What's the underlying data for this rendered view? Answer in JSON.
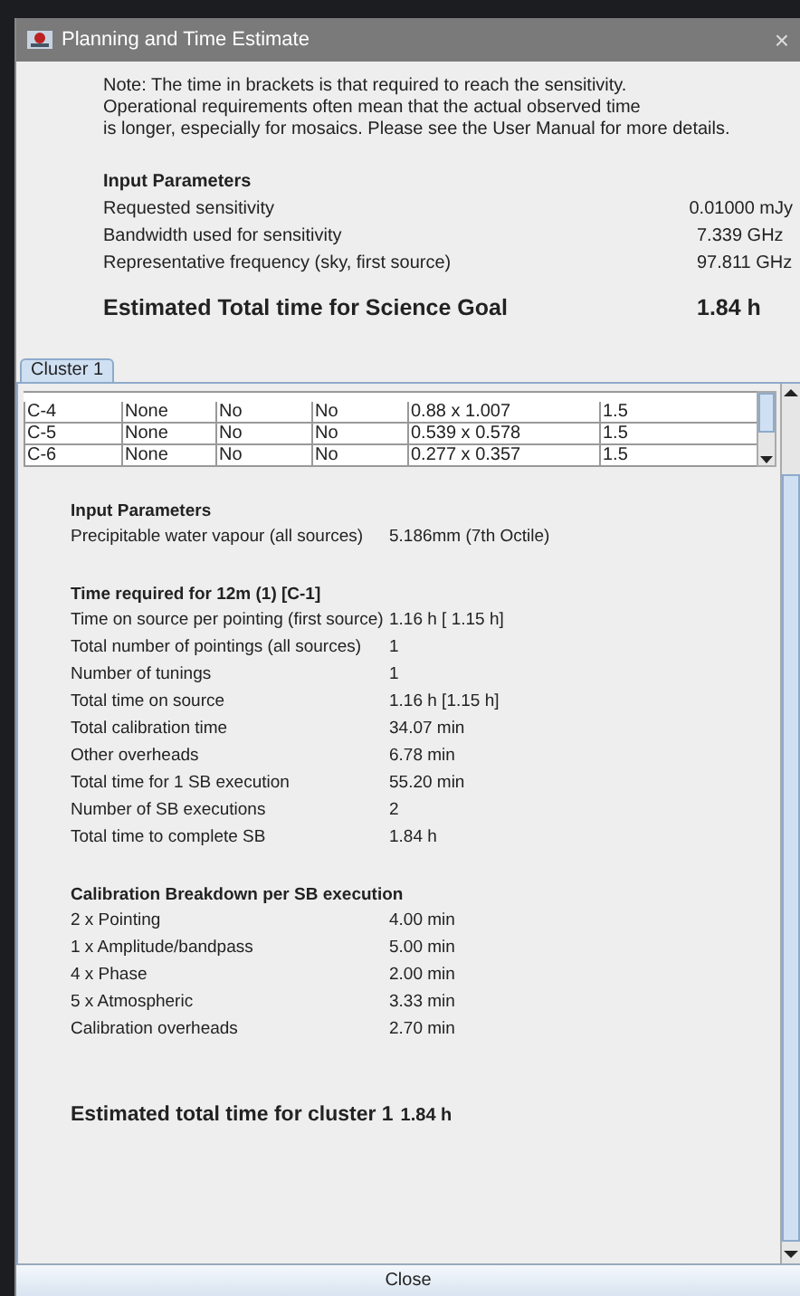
{
  "window": {
    "title": "Planning and Time Estimate",
    "close": "×"
  },
  "note": [
    "Note: The time in brackets is that required to reach the sensitivity.",
    "Operational requirements often mean that the actual observed time",
    "is longer, especially for mosaics. Please see the User Manual for more details."
  ],
  "summary": {
    "heading": "Input Parameters",
    "rows": [
      {
        "label": "Requested sensitivity",
        "value": "0.01000 mJy"
      },
      {
        "label": "Bandwidth used for sensitivity",
        "value": "7.339 GHz"
      },
      {
        "label": "Representative frequency (sky, first source)",
        "value": "97.811 GHz"
      }
    ],
    "total": {
      "label": "Estimated Total time for Science Goal",
      "value": "1.84 h"
    }
  },
  "tabs": [
    {
      "label": "Cluster 1",
      "selected": true
    }
  ],
  "table": {
    "rows": [
      [
        "C-4",
        "None",
        "No",
        "No",
        "0.88 x 1.007",
        "1.5"
      ],
      [
        "C-5",
        "None",
        "No",
        "No",
        "0.539 x 0.578",
        "1.5"
      ],
      [
        "C-6",
        "None",
        "No",
        "No",
        "0.277 x 0.357",
        "1.5"
      ]
    ]
  },
  "sections": [
    {
      "heading": "Input Parameters",
      "rows": [
        {
          "label": "Precipitable water vapour (all sources)",
          "value": "5.186mm (7th Octile)"
        }
      ]
    },
    {
      "heading": "Time required for 12m (1) [C-1]",
      "rows": [
        {
          "label": "Time on source per pointing (first source)",
          "value": "1.16 h [ 1.15 h]"
        },
        {
          "label": "Total number of pointings (all sources)",
          "value": "1"
        },
        {
          "label": "Number of tunings",
          "value": "1"
        },
        {
          "label": "Total time on source",
          "value": "1.16 h [1.15 h]"
        },
        {
          "label": "Total calibration time",
          "value": "34.07 min"
        },
        {
          "label": "Other overheads",
          "value": "6.78 min"
        },
        {
          "label": "Total time for 1 SB execution",
          "value": "55.20 min"
        },
        {
          "label": "Number of SB executions",
          "value": "2"
        },
        {
          "label": "Total time to complete SB",
          "value": "1.84 h"
        }
      ]
    },
    {
      "heading": "Calibration Breakdown per SB execution",
      "rows": [
        {
          "label": "2 x Pointing",
          "value": "4.00 min"
        },
        {
          "label": "1 x Amplitude/bandpass",
          "value": "5.00 min"
        },
        {
          "label": "4 x Phase",
          "value": "2.00 min"
        },
        {
          "label": "5 x Atmospheric",
          "value": "3.33 min"
        },
        {
          "label": "Calibration overheads",
          "value": "2.70 min"
        }
      ]
    }
  ],
  "cluster_total": {
    "label": "Estimated total time for cluster 1",
    "value": "1.84 h"
  },
  "buttons": [
    "Close"
  ]
}
